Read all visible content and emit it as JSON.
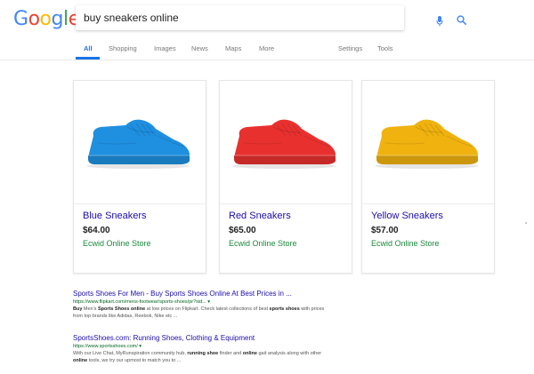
{
  "logo": {
    "letters": [
      "G",
      "o",
      "o",
      "g",
      "l",
      "e"
    ],
    "colors": [
      "#4285f4",
      "#ea4335",
      "#fbbc05",
      "#4285f4",
      "#34a853",
      "#ea4335"
    ]
  },
  "search": {
    "query": "buy sneakers online"
  },
  "tabs": {
    "all": "All",
    "shopping": "Shopping",
    "images": "Images",
    "news": "News",
    "maps": "Maps",
    "more": "More",
    "settings": "Settings",
    "tools": "Tools"
  },
  "products": [
    {
      "title": "Blue Sneakers",
      "price": "$64.00",
      "store": "Ecwid Online Store",
      "color": "#1f8fe0"
    },
    {
      "title": "Red Sneakers",
      "price": "$65.00",
      "store": "Ecwid Online Store",
      "color": "#e8312f"
    },
    {
      "title": "Yellow Sneakers",
      "price": "$57.00",
      "store": "Ecwid Online Store",
      "color": "#f0b20f"
    }
  ],
  "results": [
    {
      "title": "Sports Shoes For Men - Buy Sports Shoes Online At Best Prices in ...",
      "url": "https://www.flipkart.com/mens-footwear/sports-shoes/pr?sid... ▾",
      "snippet_html": "<b>Buy</b> Men's <b>Sports Shoes online</b> at low prices on Flipkart. Check latest collections of best <b>sports shoes</b> with prices from top brands like Adidas, Reebok, Nike etc ..."
    },
    {
      "title": "SportsShoes.com: Running Shoes, Clothing & Equipment",
      "url": "https://www.sportsshoes.com/ ▾",
      "snippet_html": "With our Live Chat, MyRunspiration community hub, <b>running shoe</b> finder and <b>online</b> gait analysis along with other <b>online</b> tools, we try our upmost to match you to ..."
    }
  ]
}
